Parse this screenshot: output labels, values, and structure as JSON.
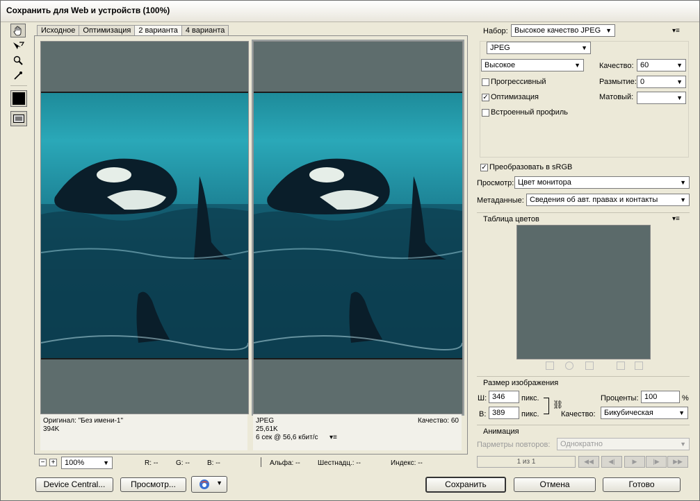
{
  "window": {
    "title": "Сохранить для Web и устройств (100%)"
  },
  "tools": [
    "hand-icon",
    "slice-select-icon",
    "zoom-icon",
    "eyedropper-icon",
    "eyedropper-color-swatch",
    "toggle-slices-icon"
  ],
  "tabs": [
    {
      "label": "Исходное",
      "selected": false
    },
    {
      "label": "Оптимизация",
      "selected": false
    },
    {
      "label": "2 варианта",
      "selected": true
    },
    {
      "label": "4 варианта",
      "selected": false
    }
  ],
  "left_pane": {
    "line1": "Оригинал: \"Без имени-1\"",
    "line2": "394K"
  },
  "right_pane": {
    "format": "JPEG",
    "quality": "Качество: 60",
    "size": "25,61K",
    "speed": "6 сек @ 56,6 кбит/с"
  },
  "statusbar": {
    "zoom": "100%",
    "r": "R: --",
    "g": "G: --",
    "b": "B: --",
    "alpha": "Альфа: --",
    "hex": "Шестнадц.: --",
    "index": "Индекс: --"
  },
  "settings": {
    "preset_label": "Набор:",
    "preset_value": "Высокое качество JPEG",
    "format_value": "JPEG",
    "compression_value": "Высокое",
    "quality_label": "Качество:",
    "quality_value": "60",
    "progressive_label": "Прогрессивный",
    "progressive_checked": false,
    "blur_label": "Размытие:",
    "blur_value": "0",
    "optimize_label": "Оптимизация",
    "optimize_checked": true,
    "matte_label": "Матовый:",
    "matte_value": "",
    "embed_profile_label": "Встроенный профиль",
    "embed_profile_checked": false,
    "srgb_label": "Преобразовать в sRGB",
    "srgb_checked": true,
    "preview_label": "Просмотр:",
    "preview_value": "Цвет монитора",
    "metadata_label": "Метаданные:",
    "metadata_value": "Сведения об авт. правах и контакты"
  },
  "color_table": {
    "title": "Таблица цветов",
    "swatch_color": "#5b6a6a"
  },
  "image_size": {
    "title": "Размер изображения",
    "width_label": "Ш:",
    "width_value": "346",
    "width_unit": "пикс.",
    "height_label": "В:",
    "height_value": "389",
    "height_unit": "пикс.",
    "percent_label": "Проценты:",
    "percent_value": "100",
    "percent_unit": "%",
    "quality_label": "Качество:",
    "quality_value": "Бикубическая"
  },
  "animation": {
    "title": "Анимация",
    "loop_label": "Парметры повторов:",
    "loop_value": "Однократно",
    "frame_counter": "1 из 1"
  },
  "buttons": {
    "device_central": "Device Central...",
    "preview": "Просмотр...",
    "save": "Сохранить",
    "cancel": "Отмена",
    "done": "Готово"
  }
}
